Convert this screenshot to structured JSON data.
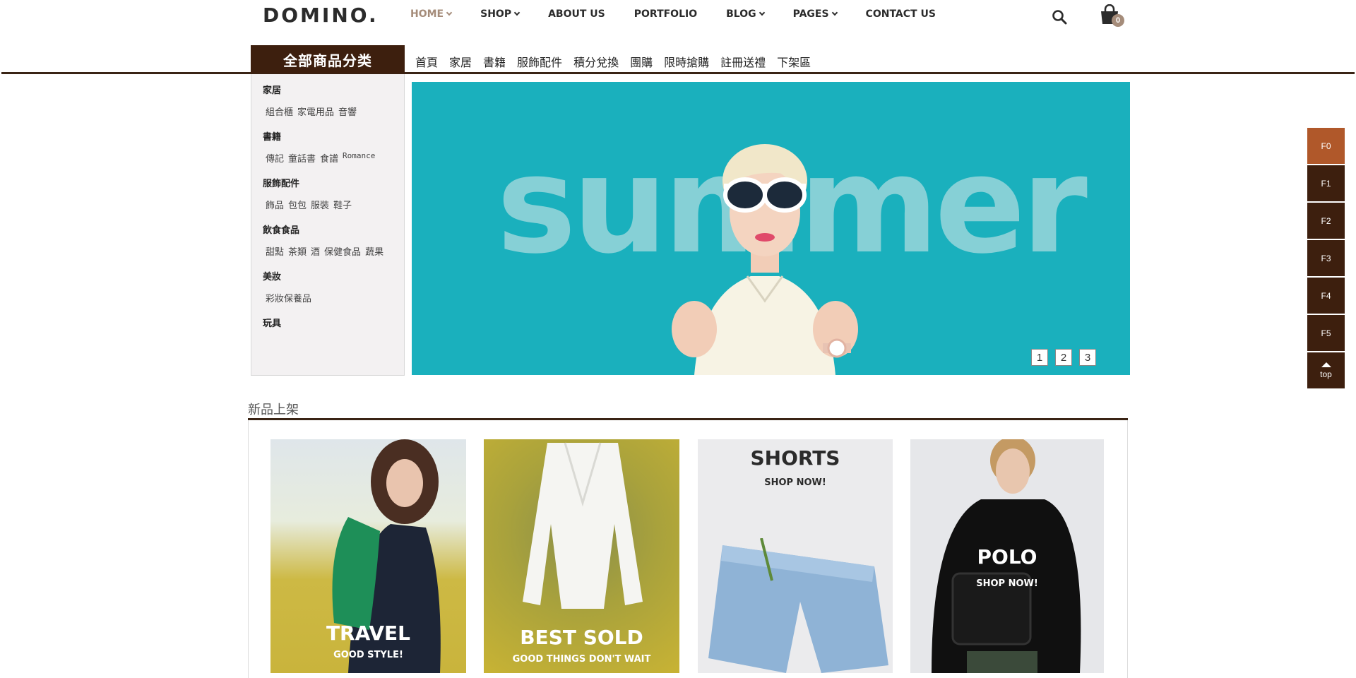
{
  "header": {
    "logo": "DOMINO.",
    "nav": [
      {
        "label": "HOME",
        "dropdown": true,
        "active": true
      },
      {
        "label": "SHOP",
        "dropdown": true
      },
      {
        "label": "ABOUT US",
        "dropdown": false
      },
      {
        "label": "PORTFOLIO",
        "dropdown": false
      },
      {
        "label": "BLOG",
        "dropdown": true
      },
      {
        "label": "PAGES",
        "dropdown": true
      },
      {
        "label": "CONTACT US",
        "dropdown": false
      }
    ],
    "cart_count": "0"
  },
  "category_bar": {
    "all_label": "全部商品分类",
    "top_links": [
      "首頁",
      "家居",
      "書籍",
      "服飾配件",
      "積分兌換",
      "團購",
      "限時搶購",
      "註冊送禮",
      "下架區"
    ]
  },
  "category_panel": [
    {
      "title": "家居",
      "subs": [
        "組合櫃",
        "家電用品",
        "音響"
      ]
    },
    {
      "title": "書籍",
      "subs": [
        "傳記",
        "童話書",
        "食譜",
        "Romance"
      ]
    },
    {
      "title": "服飾配件",
      "subs": [
        "飾品",
        "包包",
        "服裝",
        "鞋子"
      ]
    },
    {
      "title": "飲食食品",
      "subs": [
        "甜點",
        "茶類",
        "酒",
        "保健食品",
        "蔬果"
      ]
    },
    {
      "title": "美妝",
      "subs": [
        "彩妝保養品"
      ]
    },
    {
      "title": "玩具",
      "subs": []
    }
  ],
  "banner": {
    "word": "summer",
    "pages": [
      "1",
      "2",
      "3"
    ],
    "bg_color": "#1ab0bd"
  },
  "floor_nav": {
    "items": [
      "F0",
      "F1",
      "F2",
      "F3",
      "F4",
      "F5"
    ],
    "top_label": "top"
  },
  "new_arrivals": {
    "title": "新品上架",
    "cards": [
      {
        "title": "TRAVEL",
        "subtitle": "GOOD STYLE!"
      },
      {
        "title": "BEST SOLD",
        "subtitle": "GOOD THINGS DON'T WAIT"
      },
      {
        "title": "SHORTS",
        "subtitle": "SHOP NOW!"
      },
      {
        "title": "POLO",
        "subtitle": "SHOP NOW!"
      }
    ]
  },
  "colors": {
    "brand_dark": "#3d1f0e",
    "accent": "#a58c7a",
    "floor_active": "#b0582a"
  }
}
